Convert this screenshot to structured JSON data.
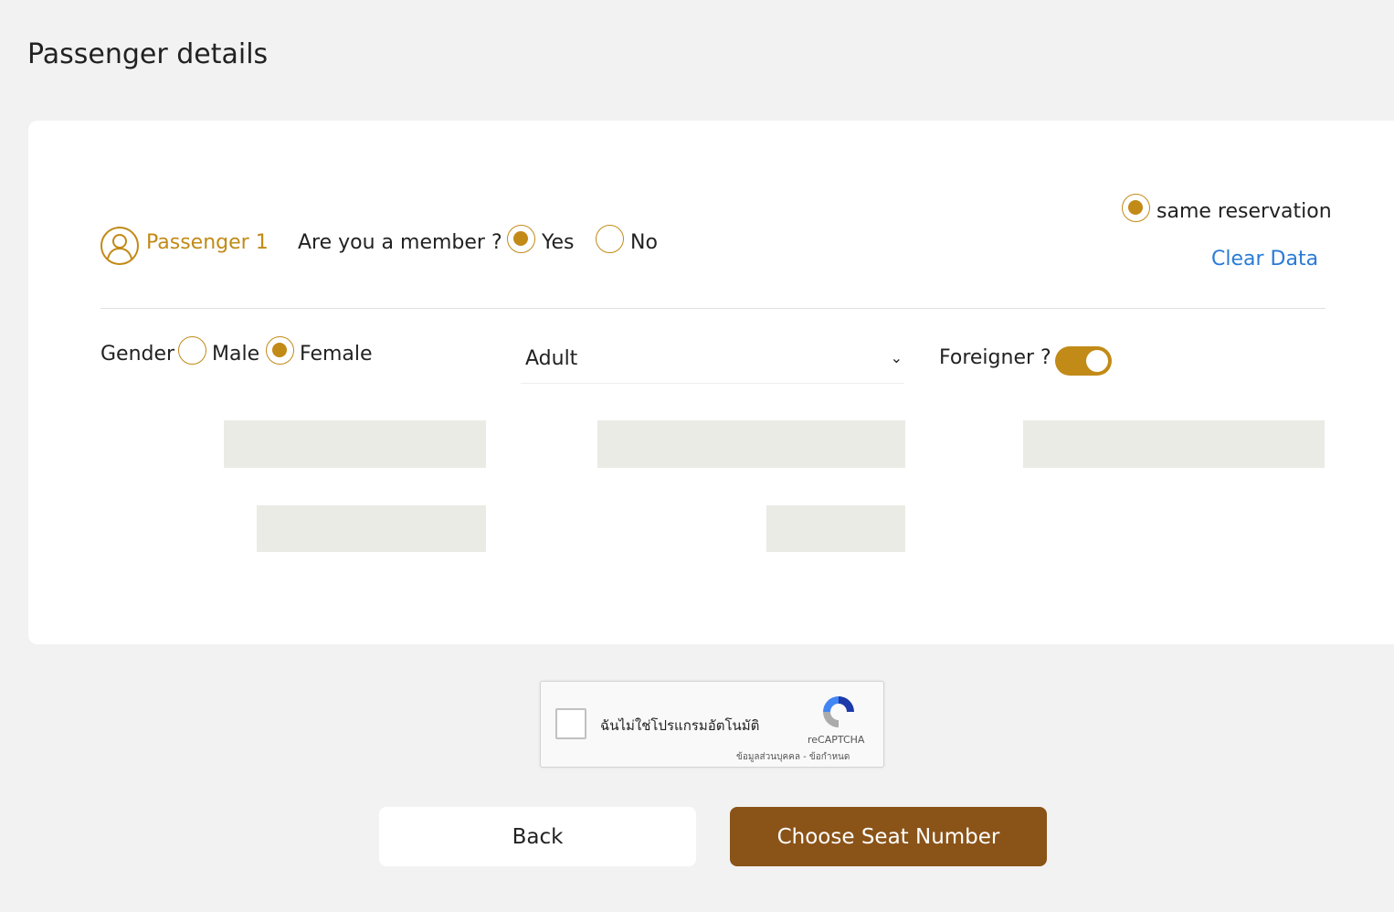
{
  "page_title": "Passenger details",
  "passenger": {
    "label": "Passenger 1",
    "member_question": "Are you a member ?",
    "yes": "Yes",
    "no": "No",
    "member_selected": "Yes"
  },
  "same_reservation": "same reservation",
  "clear_data": "Clear Data",
  "gender": {
    "label": "Gender",
    "male": "Male",
    "female": "Female",
    "selected": "Female"
  },
  "age_type": {
    "value": "Adult"
  },
  "foreigner": {
    "label": "Foreigner ?",
    "on": true
  },
  "recaptcha": {
    "label": "ฉันไม่ใช่โปรแกรมอัตโนมัติ",
    "brand": "reCAPTCHA",
    "links": "ข้อมูลส่วนบุคคล - ข้อกำหนด"
  },
  "buttons": {
    "back": "Back",
    "next": "Choose Seat Number"
  },
  "colors": {
    "accent": "#c28a17",
    "primary_button": "#8a5318",
    "link": "#2a7bd6"
  }
}
